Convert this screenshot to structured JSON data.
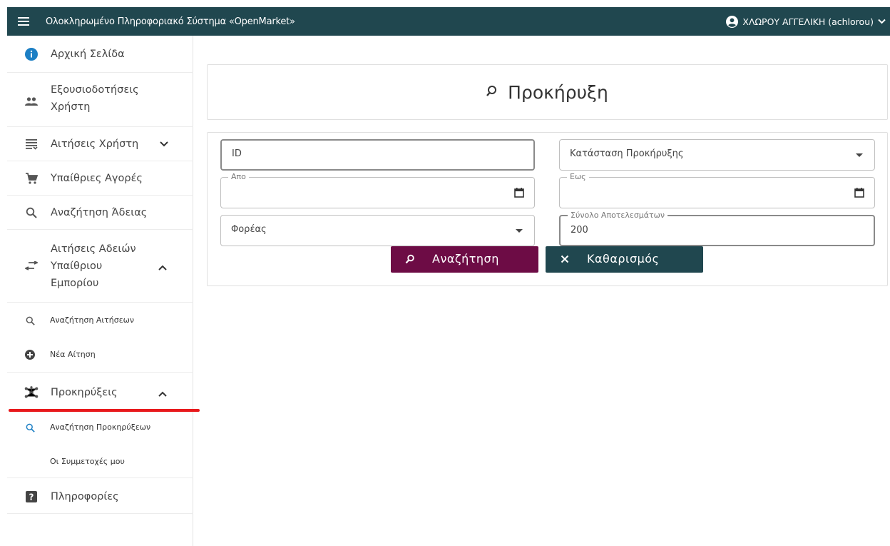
{
  "header": {
    "app_title": "Ολοκληρωμένο Πληροφοριακό Σύστημα «OpenMarket»",
    "user_name": "ΧΛΩΡΟΥ ΑΓΓΕΛΙΚΗ (achlorou)"
  },
  "sidebar": {
    "items": [
      {
        "label": "Αρχική Σελίδα",
        "icon": "info-icon"
      },
      {
        "label_line1": "Εξουσιοδοτήσεις",
        "label_line2": "Χρήστη",
        "icon": "people-icon"
      },
      {
        "label": "Αιτήσεις Χρήστη",
        "icon": "list-icon",
        "expanded": false
      },
      {
        "label": "Υπαίθριες Αγορές",
        "icon": "cart-icon"
      },
      {
        "label": "Αναζήτηση Άδειας",
        "icon": "search-icon"
      },
      {
        "label_line1": "Αιτήσεις Αδειών",
        "label_line2": "Υπαίθριου",
        "label_line3": "Εμπορίου",
        "icon": "swap-icon",
        "expanded": true
      },
      {
        "label": "Προκηρύξεις",
        "icon": "hub-icon",
        "expanded": true
      },
      {
        "label": "Πληροφορίες",
        "icon": "help-icon"
      }
    ],
    "subitems": [
      {
        "label": "Αναζήτηση Αιτήσεων",
        "icon": "search-icon"
      },
      {
        "label": "Νέα Αίτηση",
        "icon": "add-circle-icon"
      },
      {
        "label": "Αναζήτηση Προκηρύξεων",
        "icon": "search-icon",
        "active": true
      },
      {
        "label": "Οι Συμμετοχές μου"
      }
    ]
  },
  "main": {
    "page_title": "Προκήρυξη",
    "form": {
      "id_placeholder": "ID",
      "status_placeholder": "Κατάσταση Προκήρυξης",
      "from_label": "Απο",
      "to_label": "Εως",
      "agency_placeholder": "Φορέας",
      "results_label": "Σύνολο Αποτελεσμάτων",
      "results_value": "200"
    },
    "buttons": {
      "search_label": "Αναζήτηση",
      "clear_label": "Καθαρισμός"
    }
  },
  "colors": {
    "header_bg": "#20474f",
    "search_button": "#6d0c45",
    "clear_button": "#20474f",
    "active_underline": "#e8191c",
    "info_icon": "#1c7fc4"
  }
}
